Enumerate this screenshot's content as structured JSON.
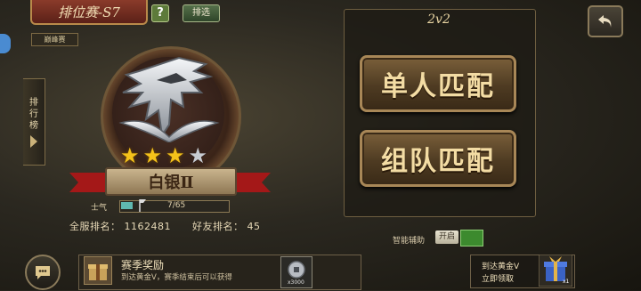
{
  "header": {
    "title": "排位赛-S7",
    "help_label": "?",
    "filter_label": "排选",
    "tier_badge": "巅峰赛"
  },
  "side": {
    "rank_tab_chars": [
      "排",
      "行",
      "榜"
    ]
  },
  "emblem": {
    "stars_filled": 3,
    "stars_total": 4,
    "rank_name": "白银Ⅱ"
  },
  "morale": {
    "label": "士气",
    "value_text": "7/65",
    "progress": 0.108
  },
  "ranks": {
    "global": "全服排名：  1162481",
    "friend": "好友排名：  45"
  },
  "match": {
    "mode": "2v2",
    "solo_label": "单人匹配",
    "team_label": "组队匹配"
  },
  "assist": {
    "label": "智能辅助",
    "state_label": "开启"
  },
  "season_reward": {
    "title": "赛季奖励",
    "desc": "到达黄金Ⅴ，赛季结束后可以获得",
    "item_count": "x3000"
  },
  "gold_reward": {
    "line1": "到达黄金Ⅴ",
    "line2": "立即领取",
    "item_count": "x1"
  },
  "colors": {
    "accent_gold": "#f3dca4",
    "star": "#f4c21a",
    "assist_on": "#3c8a2e",
    "morale_fill": "#5fb8b0"
  },
  "icons": {
    "back": "back-arrow-icon",
    "chat": "chat-bubble-icon",
    "gift": "gift-box-icon",
    "coin": "coins-icon",
    "blue": "blue-tab-icon"
  }
}
